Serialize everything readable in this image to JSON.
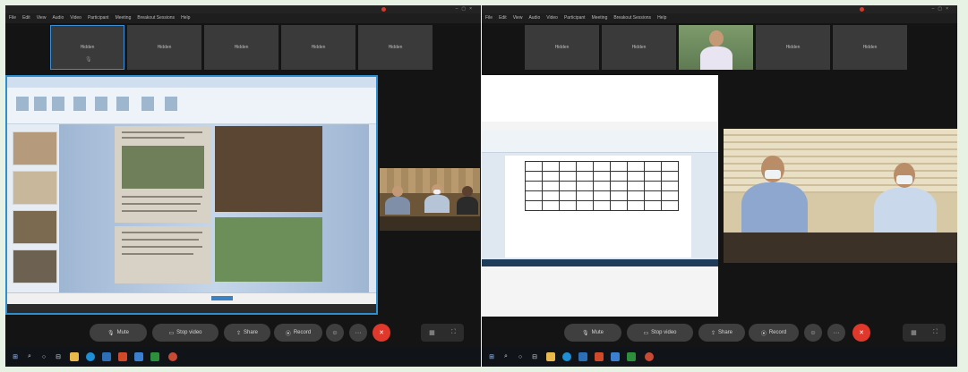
{
  "left_window": {
    "menu": [
      "File",
      "Edit",
      "View",
      "Audio",
      "Video",
      "Participant",
      "Meeting",
      "Breakout Sessions",
      "Help"
    ],
    "participants": [
      {
        "name": "Hidden",
        "active": true
      },
      {
        "name": "Hidden",
        "active": false
      },
      {
        "name": "Hidden",
        "active": false
      },
      {
        "name": "Hidden",
        "active": false
      },
      {
        "name": "Hidden",
        "active": false
      }
    ],
    "controls": {
      "mute": "Mute",
      "stop_video": "Stop video",
      "share": "Share",
      "record": "Record"
    },
    "icons": {
      "leave": "x-icon",
      "more": "more-icon",
      "reactions": "smile-icon",
      "layout": "grid-icon",
      "fullscreen": "expand-icon"
    }
  },
  "right_window": {
    "menu": [
      "File",
      "Edit",
      "View",
      "Audio",
      "Video",
      "Participant",
      "Meeting",
      "Breakout Sessions",
      "Help"
    ],
    "participants": [
      {
        "name": "Hidden",
        "active": false
      },
      {
        "name": "Hidden",
        "active": false
      },
      {
        "name": "",
        "video": true
      },
      {
        "name": "Hidden",
        "active": false
      },
      {
        "name": "Hidden",
        "active": false
      }
    ],
    "controls": {
      "mute": "Mute",
      "stop_video": "Stop video",
      "share": "Share",
      "record": "Record"
    }
  },
  "colors": {
    "accent": "#3c8fd6",
    "leave": "#e0392b",
    "background": "#141414"
  }
}
